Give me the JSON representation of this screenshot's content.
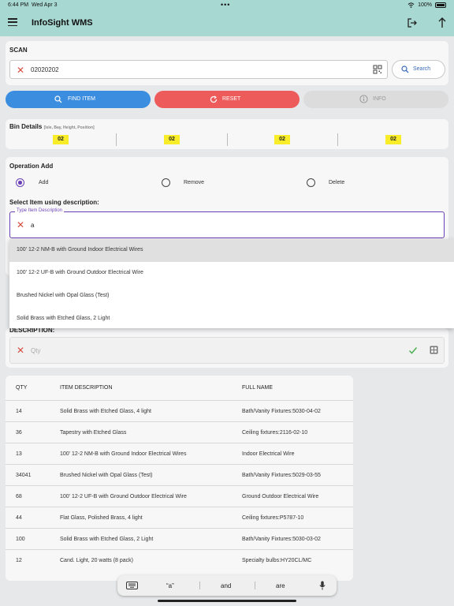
{
  "status_bar": {
    "time": "6:44 PM",
    "date": "Wed Apr 3",
    "battery": "100%"
  },
  "app": {
    "title": "InfoSight WMS"
  },
  "scan": {
    "label": "SCAN",
    "value": "02020202",
    "search_label": "Search"
  },
  "actions": {
    "find_item": "FIND ITEM",
    "reset": "RESET",
    "info": "INFO"
  },
  "bin": {
    "title": "Bin Details",
    "hint": "[Isle, Bay, Height, Position]",
    "values": [
      "02",
      "02",
      "02",
      "02"
    ]
  },
  "operation": {
    "title": "Operation Add",
    "options": [
      "Add",
      "Remove",
      "Delete"
    ],
    "selected": "Add",
    "select_label": "Select Item using description:",
    "item_field_label": "Type Item Description",
    "item_field_value": "a"
  },
  "suggestions": [
    "100' 12-2 NM-B with Ground Indoor Electrical Wires",
    "100' 12-2 UF-B with Ground Outdoor Electrical Wire",
    "Brushed Nickel with Opal Glass (Test)",
    "Solid Brass with Etched Glass, 2 Light"
  ],
  "description": {
    "label": "DESCRIPTION:",
    "qty_placeholder": "Qty"
  },
  "table": {
    "headers": [
      "QTY",
      "ITEM DESCRIPTION",
      "FULL NAME"
    ],
    "rows": [
      [
        "14",
        "Solid Brass with Etched Glass, 4 light",
        "Bath/Vanity Fixtures:5030-04-02"
      ],
      [
        "36",
        "Tapestry with Etched Glass",
        "Ceiling fixtures:2116-02-10"
      ],
      [
        "13",
        "100' 12-2 NM-B with Ground Indoor Electrical Wires",
        "Indoor Electrical Wire"
      ],
      [
        "34041",
        "Brushed Nickel with Opal Glass (Test)",
        "Bath/Vanity Fixtures:5029-03-55"
      ],
      [
        "68",
        "100' 12-2 UF-B with Ground Outdoor Electrical Wire",
        "Ground Outdoor Electrical Wire"
      ],
      [
        "44",
        "Flat Glass, Polished Brass, 4 light",
        "Ceiling fixtures:P5787-10"
      ],
      [
        "100",
        "Solid Brass with Etched Glass, 2 Light",
        "Bath/Vanity Fixtures:5030-03-02"
      ],
      [
        "12",
        "Cand. Light, 20 watts (8 pack)",
        "Specialty bulbs:HY20CL/MC"
      ]
    ]
  },
  "keyboard": {
    "suggestions": [
      "“a”",
      "and",
      "are"
    ]
  },
  "colors": {
    "app_bar": "#a8d8d2",
    "find": "#3b8ddf",
    "reset": "#ee5b5b",
    "accent": "#6b3fb5",
    "bin_highlight": "#f9ed2a"
  }
}
